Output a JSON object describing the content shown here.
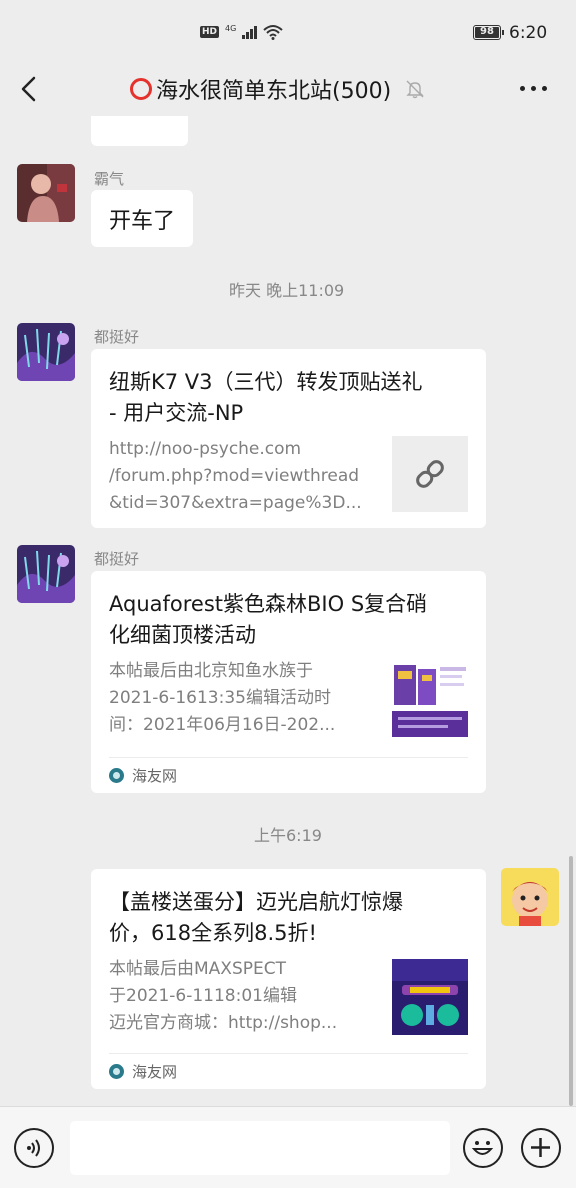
{
  "status_bar": {
    "hd_badge": "HD",
    "network": "4G",
    "battery": "98",
    "battery_level": 0.98,
    "time": "6:20"
  },
  "nav": {
    "title": "海水很简单东北站(500)",
    "title_icon": "red-circle-icon",
    "mute_icon": "bell-off-icon",
    "more_icon": "ellipsis-icon",
    "back_icon": "chevron-left-icon"
  },
  "messages": {
    "m1": {
      "sender": "霸气",
      "text": "开车了"
    },
    "time1": "昨天 晚上11:09",
    "m2": {
      "sender": "都挺好",
      "title_line1": "纽斯K7 V3（三代）转发顶贴送礼",
      "title_line2": "- 用户交流-NP",
      "desc_line1": "http://noo-psyche.com",
      "desc_line2": "/forum.php?mod=viewthread",
      "desc_line3": "&tid=307&extra=page%3D..."
    },
    "m3": {
      "sender": "都挺好",
      "title_line1": "Aquaforest紫色森林BIO S复合硝",
      "title_line2": "化细菌顶楼活动",
      "desc_line1": "本帖最后由北京知鱼水族于",
      "desc_line2": "2021-6-1613:35编辑活动时",
      "desc_line3": "间：2021年06月16日-202...",
      "source": "海友网"
    },
    "time2": "上午6:19",
    "m4": {
      "title_line1": "【盖楼送蛋分】迈光启航灯惊爆",
      "title_line2": "价，618全系列8.5折!",
      "desc_line1": "本帖最后由MAXSPECT",
      "desc_line2": "于2021-6-1118:01编辑",
      "desc_line3": "迈光官方商城：http://shop...",
      "source": "海友网"
    }
  },
  "input_bar": {
    "voice_icon": "voice-icon",
    "emoji_icon": "emoji-icon",
    "plus_icon": "plus-icon",
    "input_value": ""
  },
  "colors": {
    "background": "#ededed",
    "bubble": "#ffffff",
    "accent_red": "#e5322d"
  }
}
